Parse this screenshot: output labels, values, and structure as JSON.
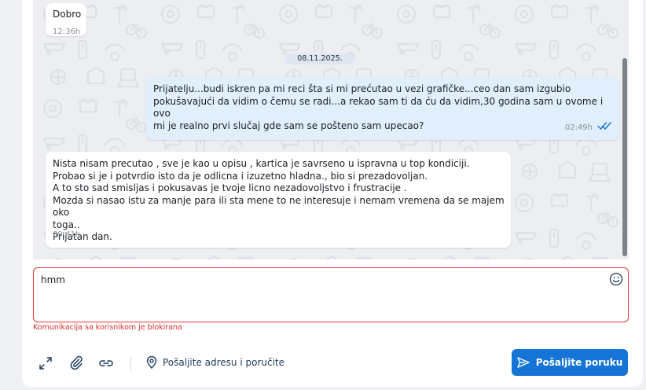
{
  "colors": {
    "accent": "#1574d6",
    "incoming_bubble": "#ffffff",
    "outgoing_bubble": "#e1effc",
    "error": "#d4312d",
    "read_ticks": "#1574d6"
  },
  "messages": [
    {
      "direction": "incoming",
      "text": "Dobro",
      "time": "12:36h"
    },
    {
      "direction": "outgoing",
      "text": "Prijatelju...budi iskren pa mi reci šta si mi prećutao u vezi grafičke...ceo dan sam izgubio\npokušavajući da vidim o čemu se radi...a rekao sam ti da ću da vidim,30 godina sam u ovome i ovo\nmi je realno prvi slučaj gde sam se pošteno sam upecao?",
      "time": "02:49h",
      "status_icon": "double-check-icon"
    },
    {
      "direction": "incoming",
      "text": "Nista nisam precutao , sve je kao u opisu , kartica je savrseno u ispravna u top kondiciji.\nProbao si je i potvrdio isto da je odlicna i izuzetno hladna., bio si prezadovoljan.\nA to sto sad smisljas i pokusavas je tvoje licno nezadovoljstvo i frustracije .\nMozda si nasao istu za manje para ili sta mene to ne interesuje i nemam vremena da se majem oko\ntoga..\nPrijatan dan.",
      "time": "09:41h"
    }
  ],
  "date_separator": "08.11.2025.",
  "compose": {
    "value": "hmm",
    "error": "Komunikacija sa korisnikom je blokirana"
  },
  "toolbar": {
    "icons": [
      "expand-icon",
      "attachment-icon",
      "link-icon"
    ],
    "address_label": "Pošaljite adresu i poručite",
    "send_label": "Pošaljite poruku"
  }
}
